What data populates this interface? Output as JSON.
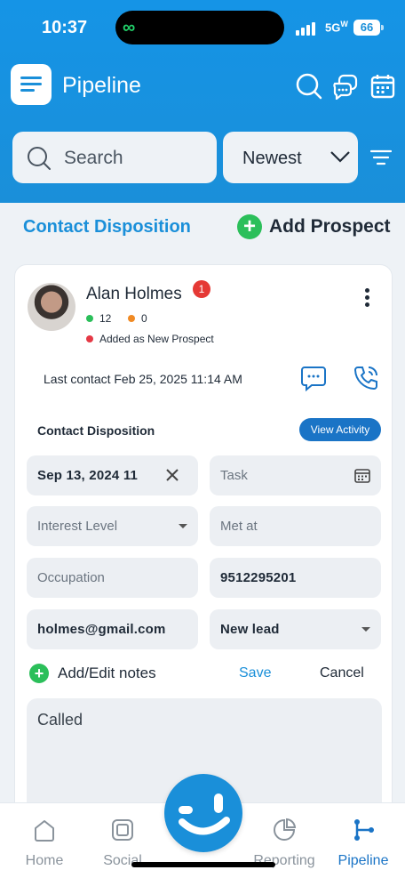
{
  "status_bar": {
    "time": "10:37",
    "network": "5G",
    "network_suffix": "W",
    "battery": "66"
  },
  "header": {
    "title": "Pipeline"
  },
  "search": {
    "placeholder": "Search",
    "sort_value": "Newest"
  },
  "section": {
    "title": "Contact Disposition",
    "add_label": "Add Prospect"
  },
  "contact": {
    "name": "Alan Holmes",
    "badge_count": "1",
    "green_count": "12",
    "orange_count": "0",
    "status": "Added as New Prospect",
    "last_contact": "Last contact Feb 25, 2025 11:14 AM"
  },
  "disposition": {
    "label": "Contact Disposition",
    "view_activity": "View Activity",
    "date_value": "Sep 13, 2024 11",
    "task_placeholder": "Task",
    "interest_placeholder": "Interest Level",
    "met_at_placeholder": "Met at",
    "occupation_placeholder": "Occupation",
    "phone_value": "9512295201",
    "email_value": "holmes@gmail.com",
    "lead_status": "New lead"
  },
  "notes": {
    "label": "Add/Edit notes",
    "save": "Save",
    "cancel": "Cancel",
    "value": "Called"
  },
  "nav": {
    "home": "Home",
    "social": "Social",
    "reporting": "Reporting",
    "pipeline": "Pipeline"
  },
  "colors": {
    "primary": "#1a8fd9",
    "accent_green": "#2bbf5a",
    "badge_red": "#e53935",
    "dot_orange": "#f08a24"
  }
}
